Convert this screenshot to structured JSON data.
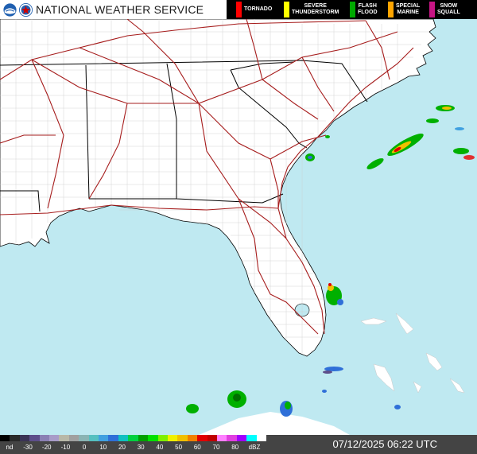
{
  "header": {
    "title": "NATIONAL WEATHER SERVICE",
    "warnings": [
      {
        "label": "TORNADO",
        "color": "#ff0000"
      },
      {
        "label": "SEVERE\nTHUNDERSTORM",
        "color": "#ffff00"
      },
      {
        "label": "FLASH\nFLOOD",
        "color": "#00aa00"
      },
      {
        "label": "SPECIAL\nMARINE",
        "color": "#ffa500"
      },
      {
        "label": "SNOW\nSQUALL",
        "color": "#c71585"
      }
    ]
  },
  "legend": {
    "unit": "dBZ",
    "nd_label": "nd",
    "ticks": [
      "-30",
      "-20",
      "-10",
      "0",
      "10",
      "20",
      "30",
      "40",
      "50",
      "60",
      "70",
      "80"
    ],
    "colors": [
      "#000000",
      "#2a2a2a",
      "#3b3355",
      "#5d4e8a",
      "#8a7fb4",
      "#a89bc8",
      "#b8b8a8",
      "#a0a0a0",
      "#8ab4b4",
      "#55c0c0",
      "#40a0e0",
      "#2f6fd8",
      "#10c0c0",
      "#00d040",
      "#00a000",
      "#00e000",
      "#80f000",
      "#f0f000",
      "#f0c000",
      "#f08000",
      "#e00000",
      "#c00000",
      "#ff80ff",
      "#e040e0",
      "#a000ff",
      "#00ffff",
      "#ffffff"
    ]
  },
  "footer": {
    "timestamp": "07/12/2025 06:22 UTC"
  },
  "colors": {
    "land": "#ffffff",
    "water": "#bfe9f1",
    "state_border": "#000000",
    "county_border": "#cccccc",
    "highway": "#a61c1c"
  }
}
